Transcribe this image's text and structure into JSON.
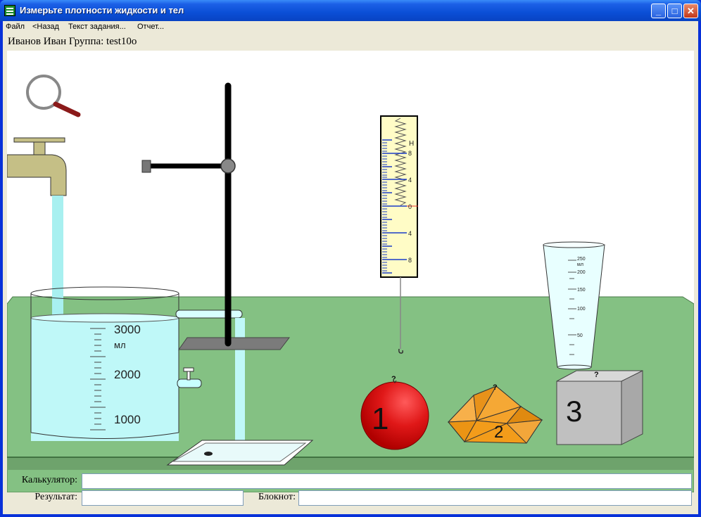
{
  "window": {
    "title": "Измерьте плотности жидкости и тел"
  },
  "menu": [
    "Файл",
    "<Назад",
    "Текст задания...",
    "Отчет..."
  ],
  "user": {
    "line": "Иванов Иван  Группа: test10o"
  },
  "beaker": {
    "labels": [
      "3000",
      "мл",
      "2000",
      "1000"
    ]
  },
  "dynamometer": {
    "unit": "Н",
    "ticks": [
      "8",
      "4",
      "0",
      "4",
      "8"
    ]
  },
  "measuring_cup": {
    "labels": [
      "250",
      "мл",
      "200",
      "150",
      "100",
      "50"
    ]
  },
  "bodies": [
    {
      "number": "1",
      "mark": "?",
      "color": "#d81010"
    },
    {
      "number": "2",
      "mark": "?",
      "color": "#f39c1a"
    },
    {
      "number": "3",
      "mark": "?",
      "color": "#c0c0c0"
    }
  ],
  "bottom": {
    "calc_label": "Калькулятор:",
    "result_label": "Результат:",
    "notepad_label": "Блокнот:",
    "calc_value": "",
    "result_value": "",
    "notepad_value": ""
  },
  "colors": {
    "table": "#84c183",
    "water": "#bff8f8",
    "titlebar": "#0a4fd6"
  }
}
